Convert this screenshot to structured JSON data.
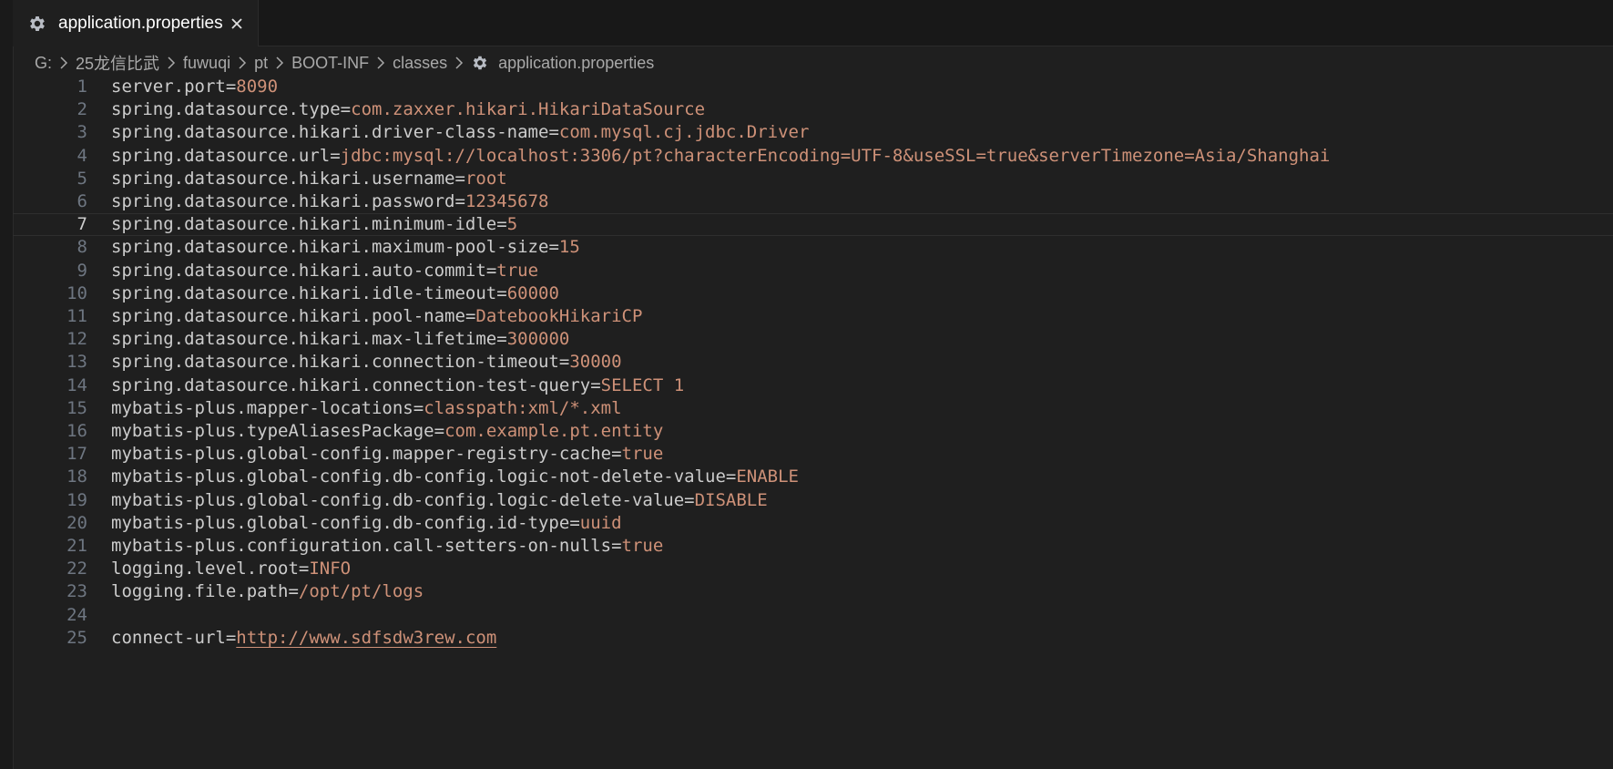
{
  "tab": {
    "label": "application.properties",
    "icon": "gear-icon",
    "close_icon": "close-icon"
  },
  "breadcrumb": [
    "G:",
    "25龙信比武",
    "fuwuqi",
    "pt",
    "BOOT-INF",
    "classes",
    "application.properties"
  ],
  "colors": {
    "background": "#1f1f1f",
    "key": "#cccccc",
    "value": "#ce9178",
    "line_number": "#6e7681"
  },
  "current_line": 7,
  "lines": [
    {
      "n": "1",
      "key": "server.port",
      "eq": "=",
      "value": "8090"
    },
    {
      "n": "2",
      "key": "spring.datasource.type",
      "eq": "=",
      "value": "com.zaxxer.hikari.HikariDataSource"
    },
    {
      "n": "3",
      "key": "spring.datasource.hikari.driver-class-name",
      "eq": "=",
      "value": "com.mysql.cj.jdbc.Driver"
    },
    {
      "n": "4",
      "key": "spring.datasource.url",
      "eq": "=",
      "value": "jdbc:mysql://localhost:3306/pt?characterEncoding=UTF-8&useSSL=true&serverTimezone=Asia/Shanghai"
    },
    {
      "n": "5",
      "key": "spring.datasource.hikari.username",
      "eq": "=",
      "value": "root"
    },
    {
      "n": "6",
      "key": "spring.datasource.hikari.password",
      "eq": "=",
      "value": "12345678"
    },
    {
      "n": "7",
      "key": "spring.datasource.hikari.minimum-idle",
      "eq": "=",
      "value": "5"
    },
    {
      "n": "8",
      "key": "spring.datasource.hikari.maximum-pool-size",
      "eq": "=",
      "value": "15"
    },
    {
      "n": "9",
      "key": "spring.datasource.hikari.auto-commit",
      "eq": "=",
      "value": "true"
    },
    {
      "n": "10",
      "key": "spring.datasource.hikari.idle-timeout",
      "eq": "=",
      "value": "60000"
    },
    {
      "n": "11",
      "key": "spring.datasource.hikari.pool-name",
      "eq": "=",
      "value": "DatebookHikariCP"
    },
    {
      "n": "12",
      "key": "spring.datasource.hikari.max-lifetime",
      "eq": "=",
      "value": "300000"
    },
    {
      "n": "13",
      "key": "spring.datasource.hikari.connection-timeout",
      "eq": "=",
      "value": "30000"
    },
    {
      "n": "14",
      "key": "spring.datasource.hikari.connection-test-query",
      "eq": "=",
      "value": "SELECT 1"
    },
    {
      "n": "15",
      "key": "mybatis-plus.mapper-locations",
      "eq": "=",
      "value": "classpath:xml/*.xml"
    },
    {
      "n": "16",
      "key": "mybatis-plus.typeAliasesPackage",
      "eq": "=",
      "value": "com.example.pt.entity"
    },
    {
      "n": "17",
      "key": "mybatis-plus.global-config.mapper-registry-cache",
      "eq": "=",
      "value": "true"
    },
    {
      "n": "18",
      "key": "mybatis-plus.global-config.db-config.logic-not-delete-value",
      "eq": "=",
      "value": "ENABLE"
    },
    {
      "n": "19",
      "key": "mybatis-plus.global-config.db-config.logic-delete-value",
      "eq": "=",
      "value": "DISABLE"
    },
    {
      "n": "20",
      "key": "mybatis-plus.global-config.db-config.id-type",
      "eq": "=",
      "value": "uuid"
    },
    {
      "n": "21",
      "key": "mybatis-plus.configuration.call-setters-on-nulls",
      "eq": "=",
      "value": "true"
    },
    {
      "n": "22",
      "key": "logging.level.root",
      "eq": "=",
      "value": "INFO"
    },
    {
      "n": "23",
      "key": "logging.file.path",
      "eq": "=",
      "value": "/opt/pt/logs"
    },
    {
      "n": "24",
      "key": "",
      "eq": "",
      "value": ""
    },
    {
      "n": "25",
      "key": "connect-url",
      "eq": "=",
      "value": "http://www.sdfsdw3rew.com",
      "link": true
    }
  ]
}
